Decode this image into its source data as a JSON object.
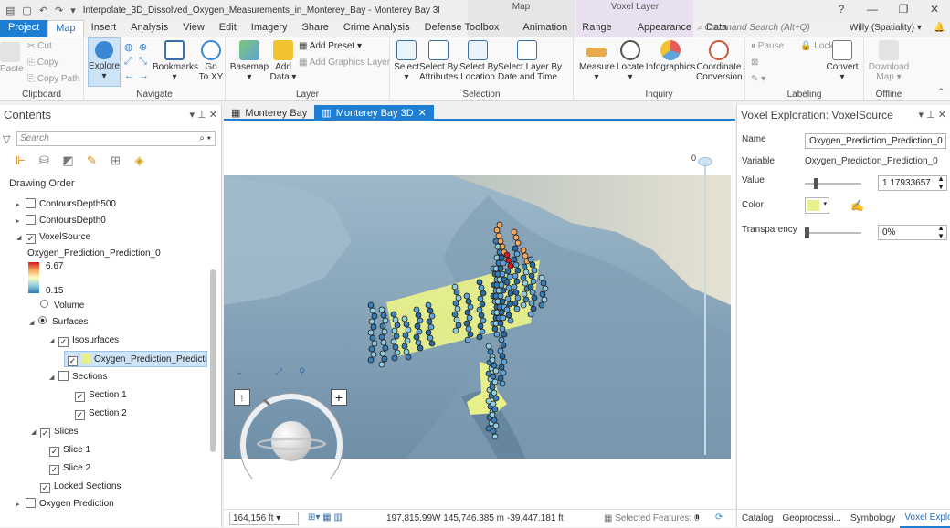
{
  "titlebar": {
    "title": "Interpolate_3D_Dissolved_Oxygen_Measurements_in_Monterey_Bay - Monterey Bay 3D - Arc...",
    "context_map": "Map",
    "context_voxel": "Voxel Layer",
    "help": "?",
    "minimize": "—",
    "restore": "❐",
    "close": "✕"
  },
  "tabs": [
    "Project",
    "Map",
    "Insert",
    "Analysis",
    "View",
    "Edit",
    "Imagery",
    "Share",
    "Crime Analysis",
    "Defense Toolbox",
    "Animation",
    "Range",
    "Appearance",
    "Data"
  ],
  "command_search_placeholder": "Command Search (Alt+Q)",
  "user": "Willy (Spatiality) ▾",
  "ribbon": {
    "clipboard": {
      "label": "Clipboard",
      "paste": "Paste",
      "cut": "Cut",
      "copy": "Copy",
      "copy_path": "Copy Path"
    },
    "navigate": {
      "label": "Navigate",
      "explore": "Explore",
      "bookmarks": "Bookmarks",
      "go_to_xy": "Go\nTo XY"
    },
    "layer": {
      "label": "Layer",
      "basemap": "Basemap",
      "add_data": "Add\nData ▾",
      "add_preset": "Add Preset ▾",
      "add_graphics_layer": "Add Graphics Layer"
    },
    "selection": {
      "label": "Selection",
      "select": "Select",
      "select_by_attributes": "Select By\nAttributes",
      "select_by_location": "Select By\nLocation",
      "select_layer_by": "Select Layer By\nDate and Time"
    },
    "inquiry": {
      "label": "Inquiry",
      "measure": "Measure",
      "locate": "Locate",
      "infographics": "Infographics",
      "coordinate_conversion": "Coordinate\nConversion"
    },
    "labeling": {
      "label": "Labeling",
      "pause": "Pause",
      "lock": "Lock",
      "convert": "Convert"
    },
    "offline": {
      "label": "Offline",
      "download_map": "Download\nMap ▾"
    }
  },
  "contents": {
    "title": "Contents",
    "search_placeholder": "Search",
    "drawing_order": "Drawing Order",
    "items": {
      "contours500": "ContoursDepth500",
      "contours0": "ContoursDepth0",
      "voxel": "VoxelSource",
      "variable": "Oxygen_Prediction_Prediction_0",
      "ramp_max": "6.67",
      "ramp_min": "0.15",
      "volume": "Volume",
      "surfaces": "Surfaces",
      "isosurfaces": "Isosurfaces",
      "iso_item": "Oxygen_Prediction_Prediction_0",
      "sections": "Sections",
      "section1": "Section 1",
      "section2": "Section 2",
      "slices": "Slices",
      "slice1": "Slice 1",
      "slice2": "Slice 2",
      "locked_sections": "Locked Sections",
      "oxygen_prediction": "Oxygen Prediction"
    }
  },
  "map": {
    "tab1": "Monterey Bay",
    "tab2": "Monterey Bay 3D",
    "height_label": "0",
    "scale": "164,156 ft",
    "coords": "197,815.99W 145,746.385 m",
    "elev": "-39,447.181 ft",
    "selected_features": "Selected Features: 0"
  },
  "panel": {
    "title": "Voxel Exploration: VoxelSource",
    "name_label": "Name",
    "name_value": "Oxygen_Prediction_Prediction_0",
    "variable_label": "Variable",
    "variable_value": "Oxygen_Prediction_Prediction_0",
    "value_label": "Value",
    "value_value": "1.17933657",
    "color_label": "Color",
    "transparency_label": "Transparency",
    "transparency_value": "0%",
    "bottom_tabs": [
      "Catalog",
      "Geoprocessi...",
      "Symbology",
      "Voxel Explorat..."
    ]
  },
  "colors": {
    "accent": "#1e7ed4",
    "isosurface": "#e8f08a",
    "ramp_high": "#d7191c",
    "ramp_low": "#2c7bb6"
  }
}
